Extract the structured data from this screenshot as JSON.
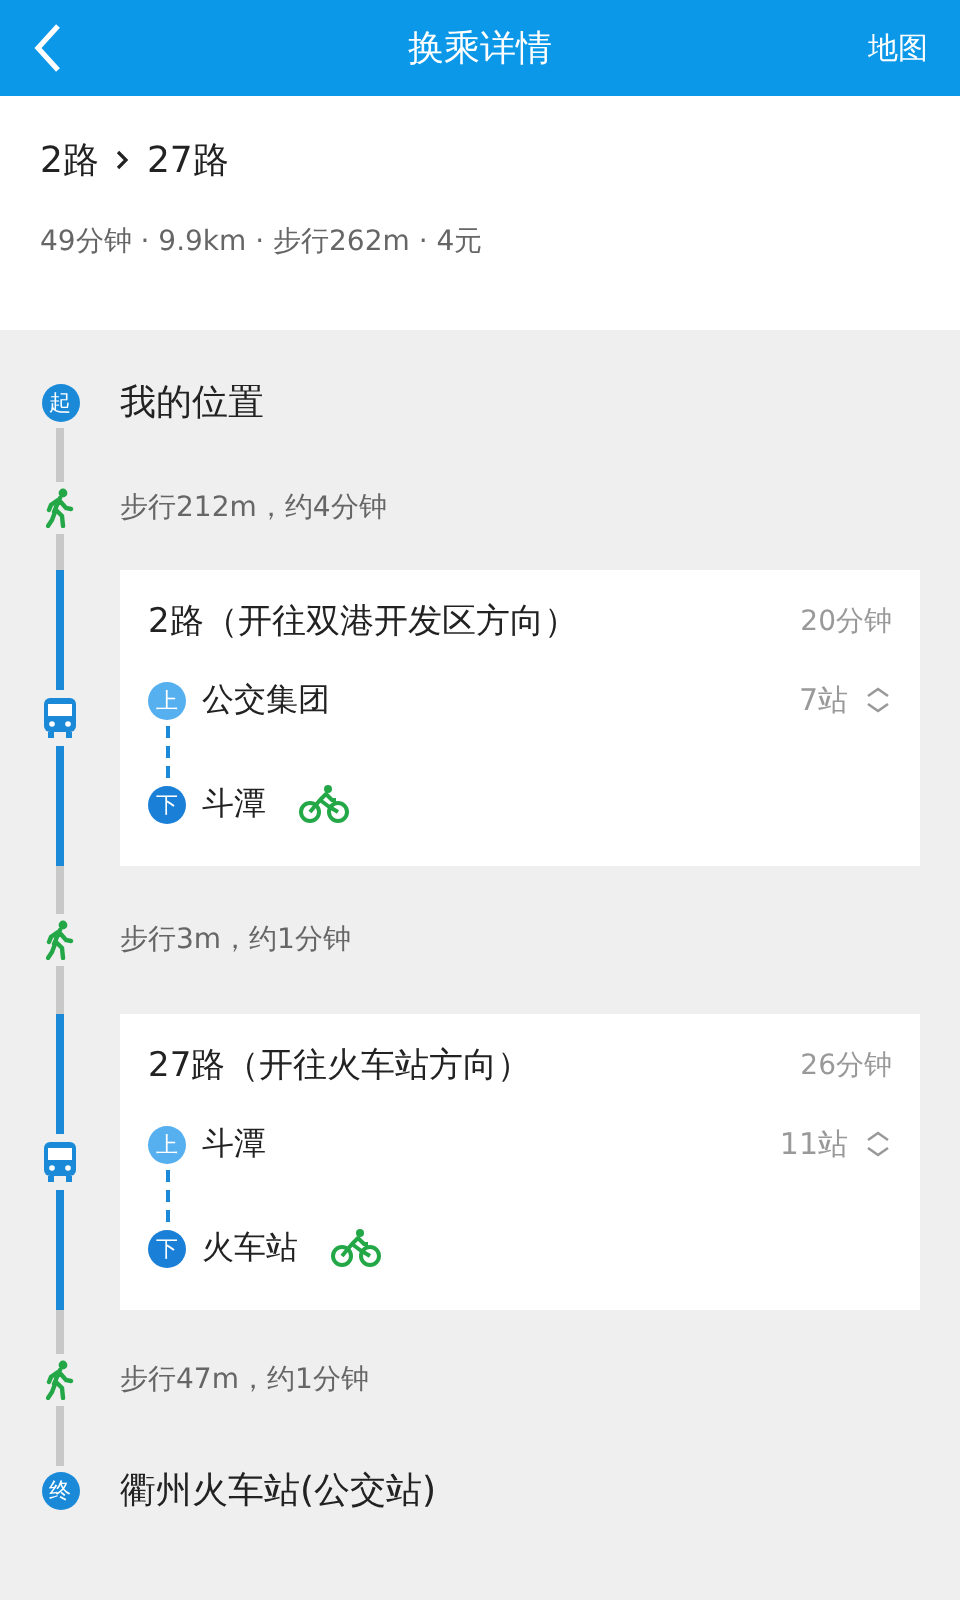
{
  "header": {
    "title": "换乘详情",
    "action": "地图"
  },
  "summary": {
    "routes": [
      "2路",
      "27路"
    ],
    "details": "49分钟 · 9.9km · 步行262m · 4元"
  },
  "steps": [
    {
      "kind": "start",
      "badge": "起",
      "text": "我的位置"
    },
    {
      "kind": "walk",
      "text": "步行212m，约4分钟"
    },
    {
      "kind": "bus",
      "line": "2路（开往双港开发区方向）",
      "duration": "20分钟",
      "board": {
        "badge": "上",
        "stop": "公交集团"
      },
      "alight": {
        "badge": "下",
        "stop": "斗潭",
        "bike": true
      },
      "stops": "7站"
    },
    {
      "kind": "walk",
      "text": "步行3m，约1分钟"
    },
    {
      "kind": "bus",
      "line": "27路（开往火车站方向）",
      "duration": "26分钟",
      "board": {
        "badge": "上",
        "stop": "斗潭"
      },
      "alight": {
        "badge": "下",
        "stop": "火车站",
        "bike": true
      },
      "stops": "11站"
    },
    {
      "kind": "walk",
      "text": "步行47m，约1分钟"
    },
    {
      "kind": "end",
      "badge": "终",
      "text": "衢州火车站(公交站)"
    }
  ]
}
